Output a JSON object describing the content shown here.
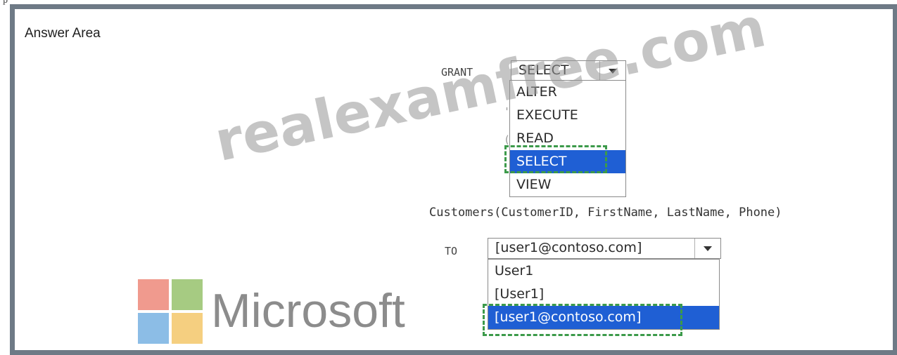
{
  "top_mark": "p",
  "answer_area": {
    "title": "Answer Area"
  },
  "statement": {
    "grant_keyword": "GRANT",
    "to_keyword": "TO",
    "table_line": "Customers(CustomerID, FirstName, LastName, Phone)",
    "obscured_fragment_1": "'",
    "obscured_fragment_2": "("
  },
  "permission_dropdown": {
    "value": "SELECT",
    "options": [
      "ALTER",
      "EXECUTE",
      "READ",
      "SELECT",
      "VIEW"
    ],
    "selected_option": "SELECT"
  },
  "principal_dropdown": {
    "value": "[user1@contoso.com]",
    "options": [
      "User1",
      "[User1]",
      "[user1@contoso.com]"
    ],
    "selected_option": "[user1@contoso.com]"
  },
  "watermark": {
    "text": "realexamfree.com"
  },
  "logo": {
    "text": "Microsoft",
    "colors": {
      "red": "#f09a8e",
      "green": "#a6cb82",
      "blue": "#8cbde6",
      "yellow": "#f5cf80"
    }
  },
  "colors": {
    "selection": "#1f5fd4",
    "highlight_dash": "#3c9a4a",
    "frame": "#6e7a86"
  }
}
